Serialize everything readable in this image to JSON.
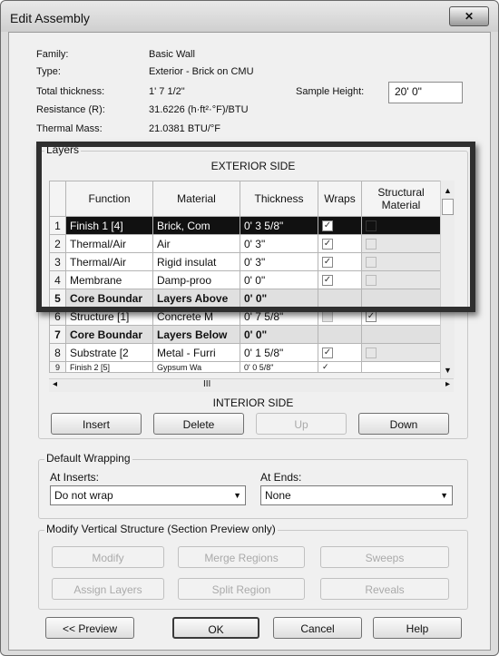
{
  "window": {
    "title": "Edit Assembly",
    "close_icon": "✕"
  },
  "info": {
    "family_label": "Family:",
    "family_value": "Basic Wall",
    "type_label": "Type:",
    "type_value": "Exterior - Brick on CMU",
    "thickness_label": "Total thickness:",
    "thickness_value": "1'  7 1/2\"",
    "resistance_label": "Resistance (R):",
    "resistance_value": "31.6226 (h·ft²·°F)/BTU",
    "mass_label": "Thermal Mass:",
    "mass_value": "21.0381 BTU/°F",
    "sample_height_label": "Sample Height:",
    "sample_height_value": "20'  0\""
  },
  "layers": {
    "group_label": "Layers",
    "exterior_label": "EXTERIOR SIDE",
    "interior_label": "INTERIOR SIDE",
    "columns": [
      "Function",
      "Material",
      "Thickness",
      "Wraps",
      "Structural Material"
    ],
    "rows": [
      {
        "num": "1",
        "function": "Finish 1 [4]",
        "material": "Brick, Com",
        "thickness": "0'  3 5/8\"",
        "wraps": "✓",
        "structural": ""
      },
      {
        "num": "2",
        "function": "Thermal/Air",
        "material": "Air",
        "thickness": "0'  3\"",
        "wraps": "✓",
        "structural": ""
      },
      {
        "num": "3",
        "function": "Thermal/Air",
        "material": "Rigid insulat",
        "thickness": "0'  3\"",
        "wraps": "✓",
        "structural": ""
      },
      {
        "num": "4",
        "function": "Membrane",
        "material": "Damp-proo",
        "thickness": "0'  0\"",
        "wraps": "✓",
        "structural": ""
      },
      {
        "num": "5",
        "function": "Core Boundar",
        "material": "Layers Above",
        "thickness": "0'  0\"",
        "wraps": "",
        "structural": ""
      },
      {
        "num": "6",
        "function": "Structure [1]",
        "material": "Concrete M",
        "thickness": "0'  7 5/8\"",
        "wraps": "",
        "structural": "✓"
      },
      {
        "num": "7",
        "function": "Core Boundar",
        "material": "Layers Below",
        "thickness": "0'  0\"",
        "wraps": "",
        "structural": ""
      },
      {
        "num": "8",
        "function": "Substrate [2",
        "material": "Metal - Furri",
        "thickness": "0'  1 5/8\"",
        "wraps": "✓",
        "structural": ""
      },
      {
        "num": "9",
        "function": "Finish 2 [5]",
        "material": "Gypsum Wa",
        "thickness": "0'  0 5/8\"",
        "wraps": "✓",
        "structural": ""
      }
    ],
    "scroll_thumb": "III",
    "buttons": {
      "insert": "Insert",
      "delete": "Delete",
      "up": "Up",
      "down": "Down"
    }
  },
  "wrapping": {
    "group_label": "Default Wrapping",
    "inserts_label": "At Inserts:",
    "inserts_value": "Do not wrap",
    "ends_label": "At Ends:",
    "ends_value": "None"
  },
  "vertical": {
    "group_label": "Modify Vertical Structure (Section Preview only)",
    "modify": "Modify",
    "merge": "Merge Regions",
    "sweeps": "Sweeps",
    "assign": "Assign Layers",
    "split": "Split Region",
    "reveals": "Reveals"
  },
  "footer": {
    "preview": "<< Preview",
    "ok": "OK",
    "cancel": "Cancel",
    "help": "Help"
  }
}
